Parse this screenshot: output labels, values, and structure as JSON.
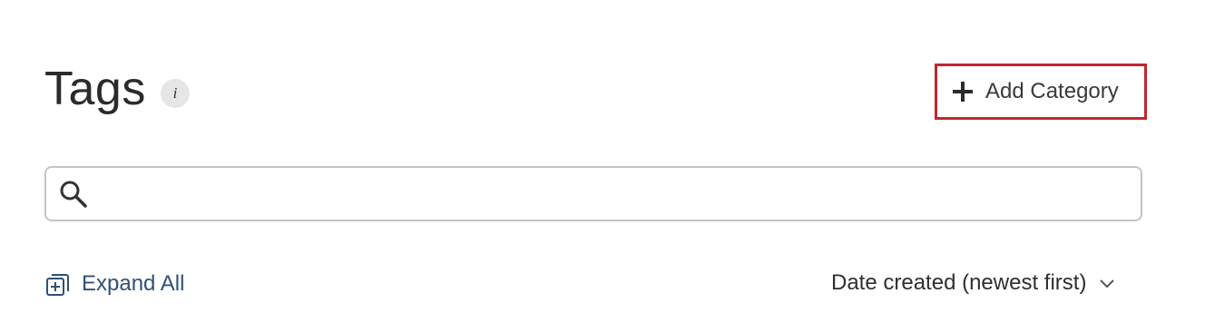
{
  "header": {
    "title": "Tags",
    "info_icon": "info-icon",
    "info_glyph": "i"
  },
  "actions": {
    "add_category_label": "Add Category",
    "add_category_icon": "plus-icon",
    "highlight_color": "#c0272d"
  },
  "search": {
    "value": "",
    "placeholder": "",
    "icon": "search-icon"
  },
  "toolbar": {
    "expand_all_label": "Expand All",
    "expand_all_icon": "expand-all-icon",
    "sort_label": "Date created (newest first)",
    "sort_icon": "chevron-down-icon",
    "link_color": "#2f5175"
  }
}
